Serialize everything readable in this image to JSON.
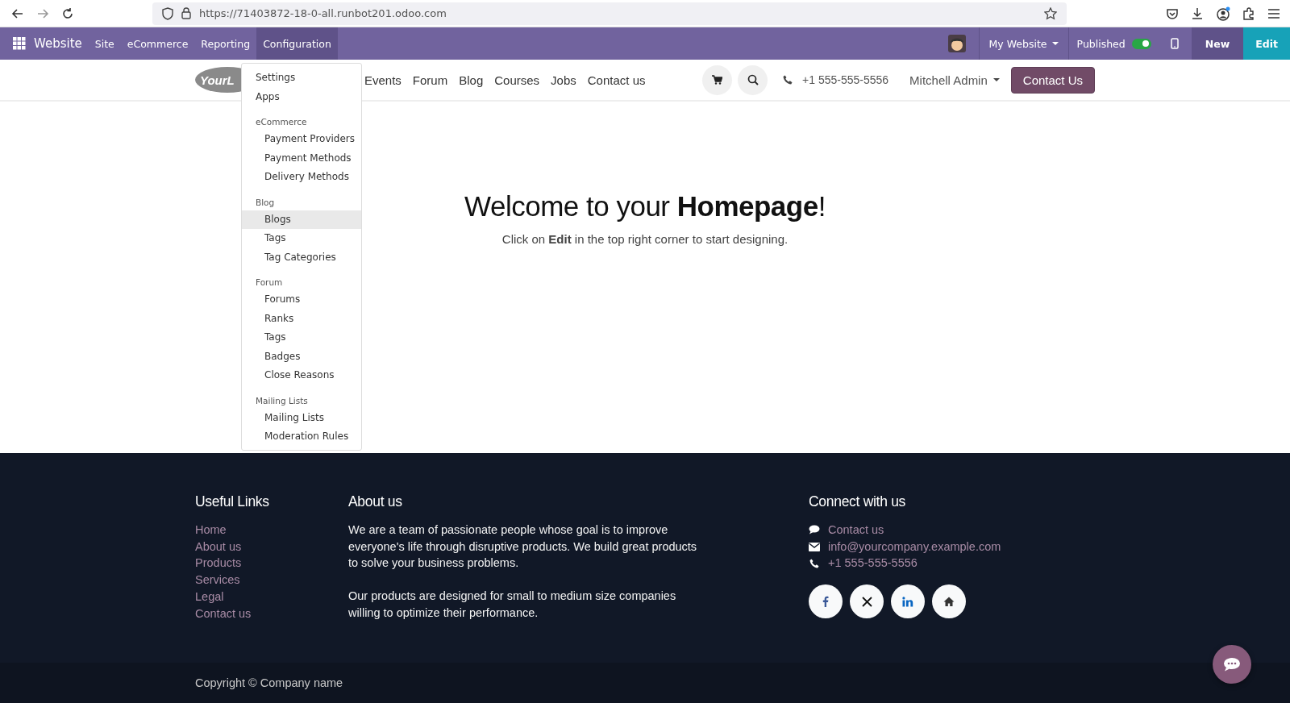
{
  "browser": {
    "url": "https://71403872-18-0-all.runbot201.odoo.com"
  },
  "navbar": {
    "app_name": "Website",
    "menus": [
      {
        "label": "Site",
        "selected": false
      },
      {
        "label": "eCommerce",
        "selected": false
      },
      {
        "label": "Reporting",
        "selected": false
      },
      {
        "label": "Configuration",
        "selected": true
      }
    ],
    "website_selector": "My Website",
    "published": {
      "label": "Published",
      "on": true
    },
    "buttons": [
      {
        "label": "New",
        "kind": "new"
      },
      {
        "label": "Edit",
        "kind": "edit"
      }
    ]
  },
  "config_menu": {
    "items": [
      {
        "label": "Settings",
        "kind": "item",
        "highlighted": false
      },
      {
        "label": "Apps",
        "kind": "item",
        "highlighted": false
      },
      {
        "label": "eCommerce",
        "kind": "header",
        "highlighted": false
      },
      {
        "label": "Payment Providers",
        "kind": "subitem",
        "highlighted": false
      },
      {
        "label": "Payment Methods",
        "kind": "subitem",
        "highlighted": false
      },
      {
        "label": "Delivery Methods",
        "kind": "subitem",
        "highlighted": false
      },
      {
        "label": "Blog",
        "kind": "header",
        "highlighted": false
      },
      {
        "label": "Blogs",
        "kind": "subitem",
        "highlighted": true
      },
      {
        "label": "Tags",
        "kind": "subitem",
        "highlighted": false
      },
      {
        "label": "Tag Categories",
        "kind": "subitem",
        "highlighted": false
      },
      {
        "label": "Forum",
        "kind": "header",
        "highlighted": false
      },
      {
        "label": "Forums",
        "kind": "subitem",
        "highlighted": false
      },
      {
        "label": "Ranks",
        "kind": "subitem",
        "highlighted": false
      },
      {
        "label": "Tags",
        "kind": "subitem",
        "highlighted": false
      },
      {
        "label": "Badges",
        "kind": "subitem",
        "highlighted": false
      },
      {
        "label": "Close Reasons",
        "kind": "subitem",
        "highlighted": false
      },
      {
        "label": "Mailing Lists",
        "kind": "header",
        "highlighted": false
      },
      {
        "label": "Mailing Lists",
        "kind": "subitem",
        "highlighted": false
      },
      {
        "label": "Moderation Rules",
        "kind": "subitem",
        "highlighted": false
      }
    ]
  },
  "site_header": {
    "logo_text": "YourL",
    "nav": [
      "Events",
      "Forum",
      "Blog",
      "Courses",
      "Jobs",
      "Contact us"
    ],
    "phone": "+1 555-555-5556",
    "user": "Mitchell Admin",
    "cta": "Contact Us"
  },
  "hero": {
    "title": "Welcome to your **Homepage**!",
    "subtitle": "Click on **Edit** in the top right corner to start designing."
  },
  "footer": {
    "useful_links": {
      "title": "Useful Links",
      "links": [
        "Home",
        "About us",
        "Products",
        "Services",
        "Legal",
        "Contact us"
      ]
    },
    "about": {
      "title": "About us",
      "paragraphs": [
        "We are a team of passionate people whose goal is to improve everyone's life through disruptive products. We build great products to solve your business problems.",
        "Our products are designed for small to medium size companies willing to optimize their performance."
      ]
    },
    "connect": {
      "title": "Connect with us",
      "contacts": [
        {
          "kind": "chat",
          "text": "Contact us"
        },
        {
          "kind": "email",
          "text": "info@yourcompany.example.com"
        },
        {
          "kind": "phone",
          "text": "+1 555-555-5556"
        }
      ],
      "socials": [
        {
          "kind": "facebook"
        },
        {
          "kind": "x"
        },
        {
          "kind": "linkedin"
        },
        {
          "kind": "home"
        }
      ]
    },
    "copyright": "Copyright © Company name"
  }
}
